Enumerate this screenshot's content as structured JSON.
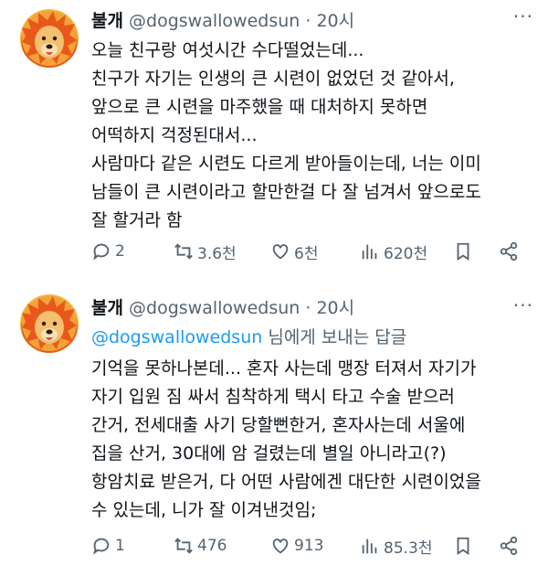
{
  "tweets": [
    {
      "name": "불개",
      "handle": "@dogswallowedsun",
      "dot": "·",
      "time": "20시",
      "more": "···",
      "lines": [
        "오늘 친구랑 여섯시간 수다떨었는데...",
        "친구가 자기는 인생의 큰 시련이 없었던 것 같아서,",
        "앞으로 큰 시련을 마주했을 때 대처하지 못하면",
        "어떡하지 걱정된대서...",
        "사람마다 같은 시련도 다르게 받아들이는데, 너는 이미",
        "남들이 큰 시련이라고 할만한걸 다 잘 넘겨서 앞으로도",
        "잘 할거라 함"
      ],
      "replies": "2",
      "reposts": "3.6천",
      "likes": "6천",
      "views": "620천"
    },
    {
      "name": "불개",
      "handle": "@dogswallowedsun",
      "dot": "·",
      "time": "20시",
      "more": "···",
      "reply_mention": "@dogswallowedsun",
      "reply_suffix": " 님에게 보내는 답글",
      "lines": [
        "기억을 못하나본데... 혼자 사는데 맹장 터져서 자기가",
        "자기 입원 짐 싸서 침착하게 택시 타고 수술 받으러",
        "간거, 전세대출 사기 당할뻔한거, 혼자사는데 서울에",
        "집을 산거, 30대에 암 걸렸는데 별일 아니라고(?)",
        "항암치료 받은거, 다 어떤 사람에겐 대단한 시련이었을",
        "수 있는데, 니가 잘 이겨낸것임;"
      ],
      "replies": "1",
      "reposts": "476",
      "likes": "913",
      "views": "85.3천"
    }
  ],
  "icons": {
    "reply": "reply-icon",
    "repost": "repost-icon",
    "like": "heart-icon",
    "views": "views-icon",
    "bookmark": "bookmark-icon",
    "share": "share-icon"
  },
  "colors": {
    "text": "#0f1419",
    "secondary": "#536471",
    "link": "#1d9bf0"
  }
}
